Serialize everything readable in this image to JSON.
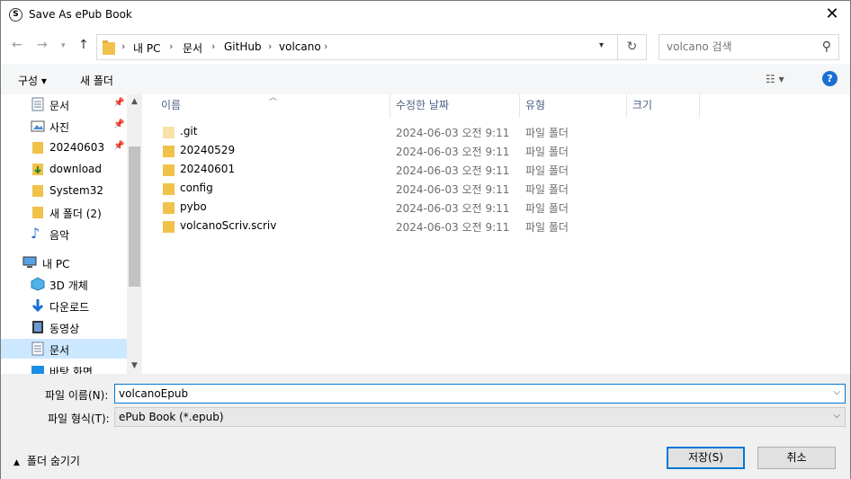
{
  "window": {
    "title": "Save As ePub Book",
    "app_icon_letter": "S"
  },
  "nav": {
    "breadcrumbs": [
      "내 PC",
      "문서",
      "GitHub",
      "volcano"
    ],
    "search_placeholder": "volcano 검색"
  },
  "toolbar": {
    "organize_label": "구성 ▾",
    "new_folder_label": "새 폴더"
  },
  "sidebar": {
    "items": [
      {
        "label": "문서",
        "icon": "document-icon",
        "pinned": true
      },
      {
        "label": "사진",
        "icon": "pictures-icon",
        "pinned": true
      },
      {
        "label": "20240603",
        "icon": "folder-icon",
        "pinned": true
      },
      {
        "label": "download",
        "icon": "download-folder-icon",
        "pinned": false
      },
      {
        "label": "System32",
        "icon": "folder-icon",
        "pinned": false
      },
      {
        "label": "새 폴더 (2)",
        "icon": "folder-icon",
        "pinned": false
      },
      {
        "label": "음악",
        "icon": "music-icon",
        "pinned": false
      },
      {
        "label": "내 PC",
        "icon": "computer-icon",
        "pinned": false
      },
      {
        "label": "3D 개체",
        "icon": "3d-objects-icon",
        "pinned": false
      },
      {
        "label": "다운로드",
        "icon": "download-arrow-icon",
        "pinned": false
      },
      {
        "label": "동영상",
        "icon": "video-icon",
        "pinned": false
      },
      {
        "label": "문서",
        "icon": "document-icon",
        "pinned": false,
        "selected": true
      },
      {
        "label": "바탕 화면",
        "icon": "desktop-icon",
        "pinned": false
      }
    ]
  },
  "files": {
    "columns": [
      "이름",
      "수정한 날짜",
      "유형",
      "크기"
    ],
    "rows": [
      {
        "name": ".git",
        "date": "2024-06-03 오전 9:11",
        "type": "파일 폴더",
        "faded": true
      },
      {
        "name": "20240529",
        "date": "2024-06-03 오전 9:11",
        "type": "파일 폴더"
      },
      {
        "name": "20240601",
        "date": "2024-06-03 오전 9:11",
        "type": "파일 폴더"
      },
      {
        "name": "config",
        "date": "2024-06-03 오전 9:11",
        "type": "파일 폴더"
      },
      {
        "name": "pybo",
        "date": "2024-06-03 오전 9:11",
        "type": "파일 폴더"
      },
      {
        "name": "volcanoScriv.scriv",
        "date": "2024-06-03 오전 9:11",
        "type": "파일 폴더"
      }
    ]
  },
  "bottom": {
    "filename_label": "파일 이름(N):",
    "filename_value": "volcanoEpub",
    "filetype_label": "파일 형식(T):",
    "filetype_value": "ePub Book (*.epub)",
    "hide_folders_label": "폴더 숨기기",
    "save_label": "저장(S)",
    "cancel_label": "취소"
  },
  "colors": {
    "accent": "#0078d7",
    "folder": "#f0c24a",
    "selected": "#cce8ff",
    "help": "#1a6fd1"
  }
}
